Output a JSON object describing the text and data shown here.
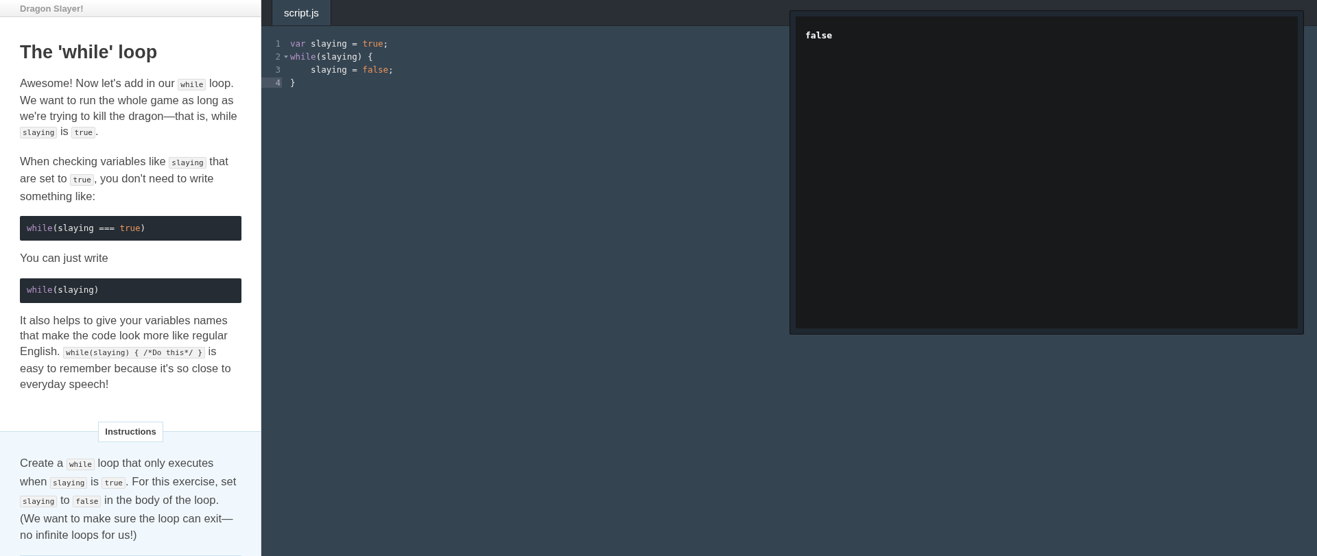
{
  "lesson": {
    "course_title": "Dragon Slayer!",
    "heading": "The 'while' loop",
    "blocks": [
      {
        "kind": "paragraph",
        "segments": [
          {
            "kind": "text",
            "text": "Awesome! Now let's add in our "
          },
          {
            "kind": "code",
            "text": "while"
          },
          {
            "kind": "text",
            "text": " loop. We want to run the whole game as long as we're trying to kill the dragon—that is, while "
          },
          {
            "kind": "code",
            "text": "slaying"
          },
          {
            "kind": "text",
            "text": " is "
          },
          {
            "kind": "code",
            "text": "true"
          },
          {
            "kind": "text",
            "text": "."
          }
        ]
      },
      {
        "kind": "paragraph",
        "segments": [
          {
            "kind": "text",
            "text": "When checking variables like "
          },
          {
            "kind": "code",
            "text": "slaying"
          },
          {
            "kind": "text",
            "text": " that are set to "
          },
          {
            "kind": "code",
            "text": "true"
          },
          {
            "kind": "text",
            "text": ", you don't need to write something like:"
          }
        ]
      },
      {
        "kind": "codeblock",
        "segments": [
          {
            "kind": "keyword",
            "text": "while"
          },
          {
            "kind": "plain",
            "text": "(slaying === "
          },
          {
            "kind": "literal",
            "text": "true"
          },
          {
            "kind": "plain",
            "text": ")"
          }
        ]
      },
      {
        "kind": "paragraph",
        "segments": [
          {
            "kind": "text",
            "text": "You can just write"
          }
        ]
      },
      {
        "kind": "codeblock",
        "segments": [
          {
            "kind": "keyword",
            "text": "while"
          },
          {
            "kind": "plain",
            "text": "(slaying)"
          }
        ]
      },
      {
        "kind": "paragraph",
        "segments": [
          {
            "kind": "text",
            "text": "It also helps to give your variables names that make the code look more like regular English. "
          },
          {
            "kind": "code",
            "text": "while(slaying) { /*Do this*/ }"
          },
          {
            "kind": "text",
            "text": " is easy to remember because it's so close to everyday speech!"
          }
        ]
      }
    ]
  },
  "instructions": {
    "label": "Instructions",
    "segments": [
      {
        "kind": "text",
        "text": "Create a "
      },
      {
        "kind": "code",
        "text": "while"
      },
      {
        "kind": "text",
        "text": " loop that only executes when "
      },
      {
        "kind": "code",
        "text": "slaying"
      },
      {
        "kind": "text",
        "text": " is "
      },
      {
        "kind": "code",
        "text": "true"
      },
      {
        "kind": "text",
        "text": ". For this exercise, set "
      },
      {
        "kind": "code",
        "text": "slaying"
      },
      {
        "kind": "text",
        "text": " to "
      },
      {
        "kind": "code",
        "text": "false"
      },
      {
        "kind": "text",
        "text": " in the body of the loop. (We want to make sure the loop can exit—no infinite loops for us!)"
      }
    ]
  },
  "editor": {
    "tabs": [
      {
        "label": "script.js",
        "selected": true
      }
    ],
    "lines": [
      {
        "number": "1",
        "active": false,
        "foldable": false,
        "tokens": [
          {
            "kind": "keyword",
            "text": "var"
          },
          {
            "kind": "plain",
            "text": " slaying = "
          },
          {
            "kind": "literal",
            "text": "true"
          },
          {
            "kind": "plain",
            "text": ";"
          }
        ]
      },
      {
        "number": "2",
        "active": false,
        "foldable": true,
        "tokens": [
          {
            "kind": "keyword",
            "text": "while"
          },
          {
            "kind": "plain",
            "text": "(slaying) {"
          }
        ]
      },
      {
        "number": "3",
        "active": false,
        "foldable": false,
        "tokens": [
          {
            "kind": "plain",
            "text": "    slaying = "
          },
          {
            "kind": "literal",
            "text": "false"
          },
          {
            "kind": "plain",
            "text": ";"
          }
        ]
      },
      {
        "number": "4",
        "active": true,
        "foldable": false,
        "tokens": [
          {
            "kind": "plain",
            "text": "}"
          }
        ]
      }
    ]
  },
  "console": {
    "output": "false"
  }
}
